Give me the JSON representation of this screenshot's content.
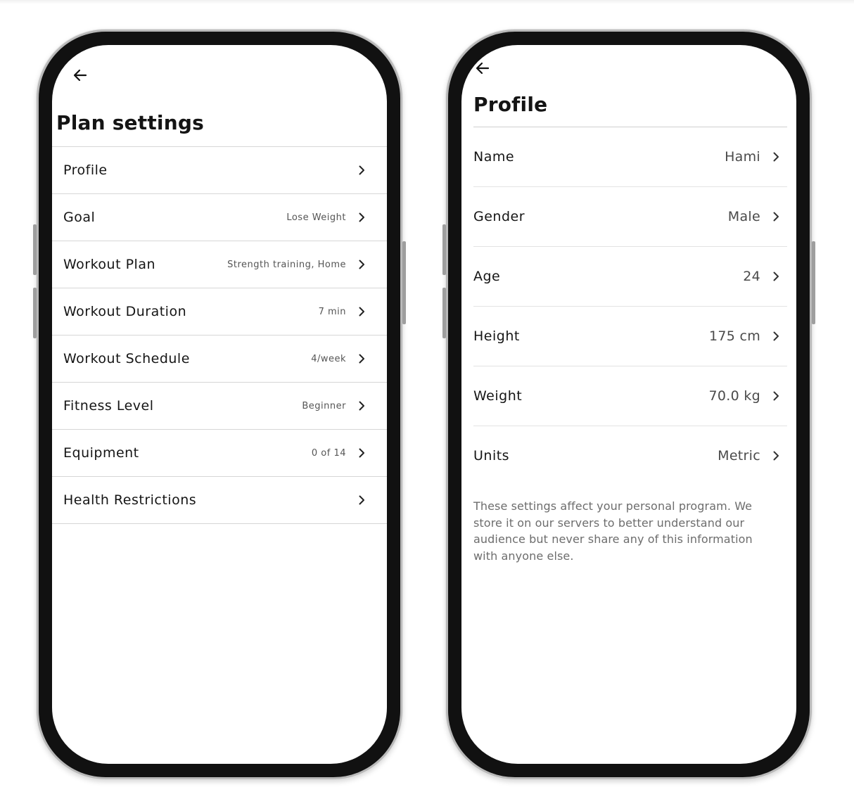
{
  "plan_settings": {
    "back_label": "Back",
    "title": "Plan settings",
    "items": [
      {
        "label": "Profile",
        "value": ""
      },
      {
        "label": "Goal",
        "value": "Lose Weight"
      },
      {
        "label": "Workout Plan",
        "value": "Strength training, Home"
      },
      {
        "label": "Workout Duration",
        "value": "7 min"
      },
      {
        "label": "Workout Schedule",
        "value": "4/week"
      },
      {
        "label": "Fitness Level",
        "value": "Beginner"
      },
      {
        "label": "Equipment",
        "value": "0 of 14"
      },
      {
        "label": "Health Restrictions",
        "value": ""
      }
    ]
  },
  "profile": {
    "title": "Profile",
    "items": [
      {
        "label": "Name",
        "value": "Hami"
      },
      {
        "label": "Gender",
        "value": "Male"
      },
      {
        "label": "Age",
        "value": "24"
      },
      {
        "label": "Height",
        "value": "175 cm"
      },
      {
        "label": "Weight",
        "value": "70.0 kg"
      },
      {
        "label": "Units",
        "value": "Metric"
      }
    ],
    "note": "These settings affect your personal program. We store it on our servers to better understand our audience but never share any of this information with anyone else."
  },
  "icons": {
    "back": "arrow-left-icon",
    "row_action": "chevron-right-icon"
  },
  "colors": {
    "text": "#141414",
    "secondary_text": "#555555",
    "divider": "#d6d6d6",
    "device_frame": "#111111"
  }
}
